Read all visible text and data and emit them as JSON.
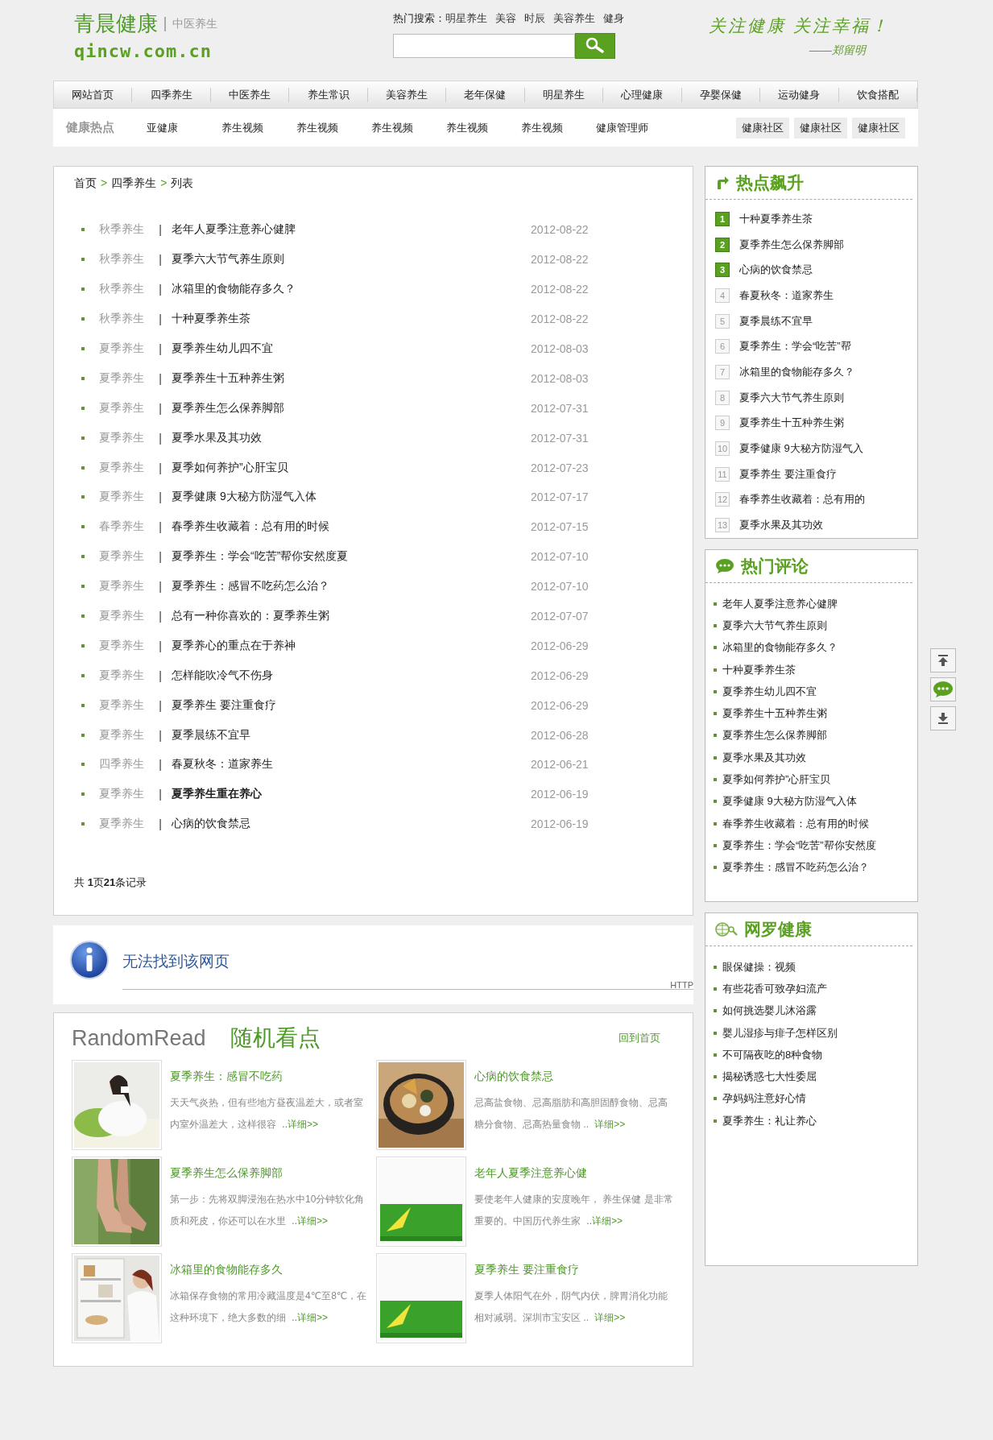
{
  "header": {
    "logo_title": "青晨健康",
    "logo_tag": "中医养生",
    "logo_domain": "qincw.com.cn",
    "hot_search_label": "热门搜索：",
    "hot_searches": [
      "明星养生",
      "美容",
      "时辰",
      "美容养生",
      "健身"
    ],
    "slogan": "关注健康 关注幸福！",
    "signature": "——郑留明"
  },
  "nav": [
    "网站首页",
    "四季养生",
    "中医养生",
    "养生常识",
    "美容养生",
    "老年保健",
    "明星养生",
    "心理健康",
    "孕婴保健",
    "运动健身",
    "饮食搭配"
  ],
  "subnav": {
    "title": "健康热点",
    "links": [
      "亚健康",
      "养生视频",
      "养生视频",
      "养生视频",
      "养生视频",
      "养生视频",
      "健康管理师"
    ],
    "community": [
      "健康社区",
      "健康社区",
      "健康社区"
    ]
  },
  "breadcrumb": {
    "items": [
      "首页",
      "四季养生",
      "列表"
    ],
    "separator": ">"
  },
  "article_separator": "|",
  "articles": [
    {
      "category": "秋季养生",
      "title": "老年人夏季注意养心健脾",
      "date": "2012-08-22",
      "bold": false
    },
    {
      "category": "秋季养生",
      "title": "夏季六大节气养生原则",
      "date": "2012-08-22",
      "bold": false
    },
    {
      "category": "秋季养生",
      "title": "冰箱里的食物能存多久？",
      "date": "2012-08-22",
      "bold": false
    },
    {
      "category": "秋季养生",
      "title": "十种夏季养生茶",
      "date": "2012-08-22",
      "bold": false
    },
    {
      "category": "夏季养生",
      "title": "夏季养生幼儿四不宜",
      "date": "2012-08-03",
      "bold": false
    },
    {
      "category": "夏季养生",
      "title": "夏季养生十五种养生粥",
      "date": "2012-08-03",
      "bold": false
    },
    {
      "category": "夏季养生",
      "title": "夏季养生怎么保养脚部",
      "date": "2012-07-31",
      "bold": false
    },
    {
      "category": "夏季养生",
      "title": "夏季水果及其功效",
      "date": "2012-07-31",
      "bold": false
    },
    {
      "category": "夏季养生",
      "title": "夏季如何养护”心肝宝贝",
      "date": "2012-07-23",
      "bold": false
    },
    {
      "category": "夏季养生",
      "title": "夏季健康 9大秘方防湿气入体",
      "date": "2012-07-17",
      "bold": false
    },
    {
      "category": "春季养生",
      "title": "春季养生收藏着：总有用的时候",
      "date": "2012-07-15",
      "bold": false
    },
    {
      "category": "夏季养生",
      "title": "夏季养生：学会“吃苦”帮你安然度夏",
      "date": "2012-07-10",
      "bold": false
    },
    {
      "category": "夏季养生",
      "title": "夏季养生：感冒不吃药怎么治？",
      "date": "2012-07-10",
      "bold": false
    },
    {
      "category": "夏季养生",
      "title": "总有一种你喜欢的：夏季养生粥",
      "date": "2012-07-07",
      "bold": false
    },
    {
      "category": "夏季养生",
      "title": "夏季养心的重点在于养神",
      "date": "2012-06-29",
      "bold": false
    },
    {
      "category": "夏季养生",
      "title": "怎样能吹冷气不伤身",
      "date": "2012-06-29",
      "bold": false
    },
    {
      "category": "夏季养生",
      "title": "夏季养生 要注重食疗",
      "date": "2012-06-29",
      "bold": false
    },
    {
      "category": "夏季养生",
      "title": "夏季晨练不宜早",
      "date": "2012-06-28",
      "bold": false
    },
    {
      "category": "四季养生",
      "title": "春夏秋冬：道家养生",
      "date": "2012-06-21",
      "bold": false
    },
    {
      "category": "夏季养生",
      "title": "夏季养生重在养心",
      "date": "2012-06-19",
      "bold": true
    },
    {
      "category": "夏季养生",
      "title": "心病的饮食禁忌",
      "date": "2012-06-19",
      "bold": false
    }
  ],
  "pagination": "共 **1**页**21**条记录",
  "error_notice": {
    "title": "无法找到该网页",
    "code": "HTTP"
  },
  "random_read": {
    "title_en": "RandomRead",
    "title_cn": "随机看点",
    "home_link": "回到首页",
    "items": [
      {
        "kind": "picture",
        "title": "夏季养生：感冒不吃药",
        "summary": "天天气炎热，但有些地方昼夜温差大，或者室内室外温差大，这样很容",
        "more": "..详细>>"
      },
      {
        "kind": "picture",
        "title": "心病的饮食禁忌",
        "summary": "忌高盐食物、忌高脂肪和高胆固醇食物、忌高糖分食物、忌高热量食物 ..",
        "more": "详细>>"
      },
      {
        "kind": "picture",
        "title": "夏季养生怎么保养脚部",
        "summary": "第一步：先将双脚浸泡在热水中10分钟软化角质和死皮，你还可以在水里",
        "more": "..详细>>"
      },
      {
        "kind": "picture",
        "title": "老年人夏季注意养心健",
        "summary": "要使老年人健康的安度晚年， 养生保健 是非常重要的。中国历代养生家",
        "more": "..详细>>"
      },
      {
        "kind": "picture",
        "title": "冰箱里的食物能存多久",
        "summary": "冰箱保存食物的常用冷藏温度是4℃至8℃，在这种环境下，绝大多数的细",
        "more": "..详细>>"
      },
      {
        "kind": "picture",
        "title": "夏季养生 要注重食疗",
        "summary": "夏季人体阳气在外，阴气内伏，脾胃消化功能相对减弱。深圳市宝安区 ..",
        "more": "详细>>"
      }
    ]
  },
  "hot_rising": {
    "title": "热点飙升",
    "items": [
      {
        "rank": "1",
        "title": "十种夏季养生茶",
        "top": true
      },
      {
        "rank": "2",
        "title": "夏季养生怎么保养脚部",
        "top": true
      },
      {
        "rank": "3",
        "title": "心病的饮食禁忌",
        "top": true
      },
      {
        "rank": "4",
        "title": "春夏秋冬：道家养生",
        "top": false
      },
      {
        "rank": "5",
        "title": "夏季晨练不宜早",
        "top": false
      },
      {
        "rank": "6",
        "title": "夏季养生：学会“吃苦”帮",
        "top": false
      },
      {
        "rank": "7",
        "title": "冰箱里的食物能存多久？",
        "top": false
      },
      {
        "rank": "8",
        "title": "夏季六大节气养生原则",
        "top": false
      },
      {
        "rank": "9",
        "title": "夏季养生十五种养生粥",
        "top": false
      },
      {
        "rank": "10",
        "title": "夏季健康 9大秘方防湿气入",
        "top": false
      },
      {
        "rank": "11",
        "title": "夏季养生 要注重食疗",
        "top": false
      },
      {
        "rank": "12",
        "title": "春季养生收藏着：总有用的",
        "top": false
      },
      {
        "rank": "13",
        "title": "夏季水果及其功效",
        "top": false
      }
    ]
  },
  "hot_comments": {
    "title": "热门评论",
    "items": [
      "老年人夏季注意养心健脾",
      "夏季六大节气养生原则",
      "冰箱里的食物能存多久？",
      "十种夏季养生茶",
      "夏季养生幼儿四不宜",
      "夏季养生十五种养生粥",
      "夏季养生怎么保养脚部",
      "夏季水果及其功效",
      "夏季如何养护”心肝宝贝",
      "夏季健康 9大秘方防湿气入体",
      "春季养生收藏着：总有用的时候",
      "夏季养生：学会“吃苦”帮你安然度",
      "夏季养生：感冒不吃药怎么治？"
    ]
  },
  "web_health": {
    "title": "网罗健康",
    "items": [
      "眼保健操：视频",
      "有些花香可致孕妇流产",
      "如何挑选婴儿沐浴露",
      "婴儿湿疹与痱子怎样区别",
      "不可隔夜吃的8种食物",
      "揭秘诱惑七大性委屈",
      "孕妈妈注意好心情",
      "夏季养生：礼让养心"
    ]
  }
}
